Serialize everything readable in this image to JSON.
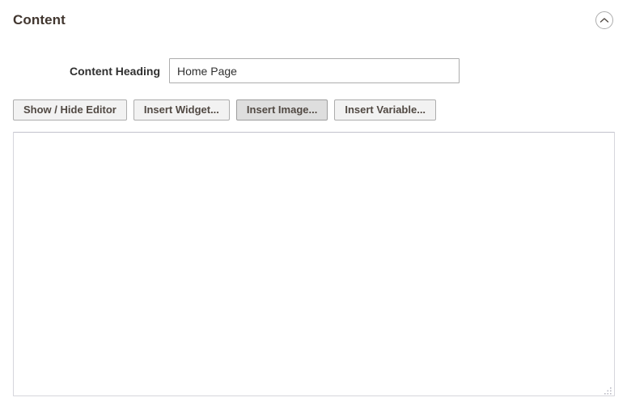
{
  "section": {
    "title": "Content",
    "collapse_icon": "chevron-up-icon",
    "collapse_aria": "Collapse Content section"
  },
  "field": {
    "label": "Content Heading",
    "value": "Home Page",
    "placeholder": ""
  },
  "toolbar": {
    "buttons": [
      {
        "label": "Show / Hide Editor",
        "state": "normal"
      },
      {
        "label": "Insert Widget...",
        "state": "normal"
      },
      {
        "label": "Insert Image...",
        "state": "hovered"
      },
      {
        "label": "Insert Variable...",
        "state": "normal"
      }
    ]
  },
  "editor": {
    "value": "",
    "placeholder": ""
  },
  "colors": {
    "title_text": "#41362f",
    "label_text": "#303030",
    "button_face": "#f2f2f2",
    "button_face_hover": "#dedede",
    "button_border": "#adadad",
    "button_text": "#514943",
    "input_border": "#adadad",
    "textarea_border": "#d6d6dc",
    "page_background": "#ffffff"
  }
}
